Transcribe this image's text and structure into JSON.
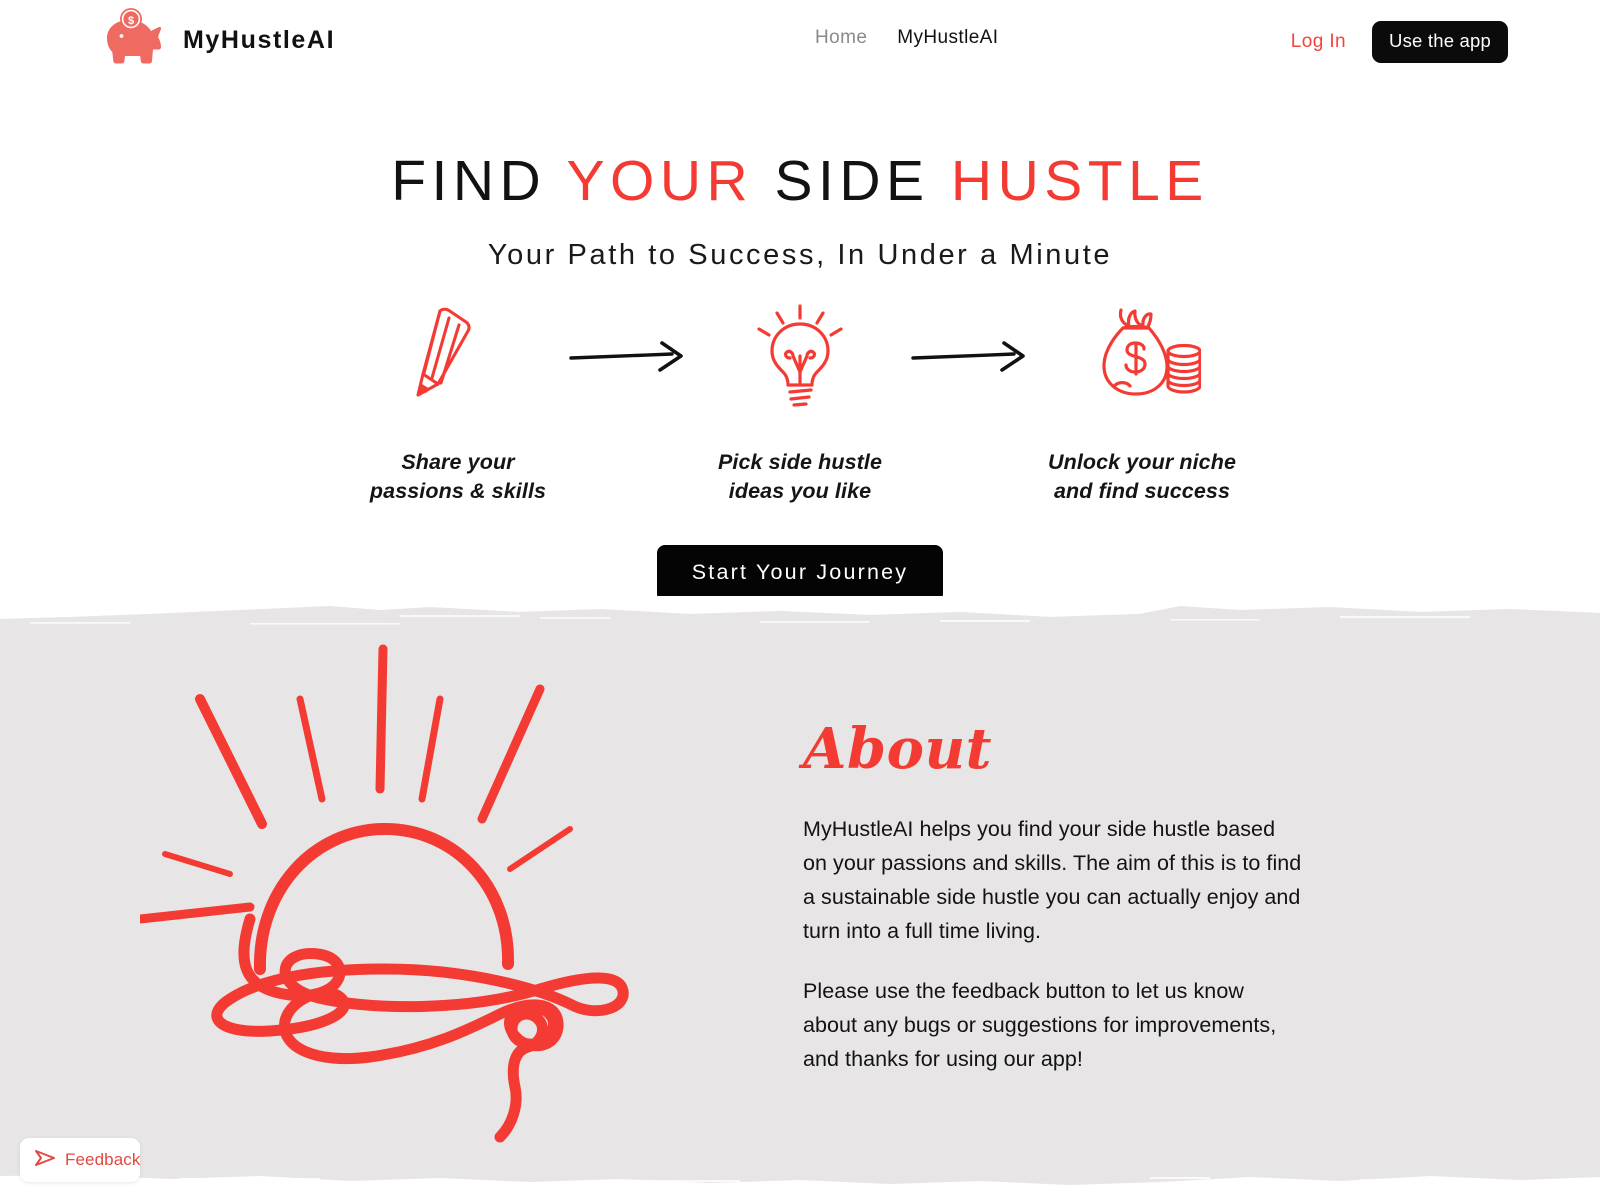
{
  "colors": {
    "brand_red": "#f43b33",
    "logo_pink": "#ef6a61",
    "ink_black": "#121212",
    "section_gray": "#e7e5e5",
    "muted_gray": "#8a8a8a"
  },
  "header": {
    "brand_name": "MyHustleAI",
    "logo_icon": "piggy-bank-icon",
    "nav": [
      {
        "label": "Home",
        "active": false
      },
      {
        "label": "MyHustleAI",
        "active": true
      }
    ],
    "login_label": "Log In",
    "cta_label": "Use the app"
  },
  "hero": {
    "headline_parts": [
      {
        "text": "FIND",
        "color": "dark"
      },
      {
        "text": "YOUR",
        "color": "red"
      },
      {
        "text": "SIDE",
        "color": "dark"
      },
      {
        "text": "HUSTLE",
        "color": "red"
      }
    ],
    "headline_plain": "FIND YOUR SIDE HUSTLE",
    "subheadline": "Your Path to Success, In Under a Minute",
    "steps": [
      {
        "icon": "pencil-icon",
        "label": "Share your\npassions & skills"
      },
      {
        "icon": "lightbulb-icon",
        "label": "Pick side hustle\nideas you like"
      },
      {
        "icon": "money-bag-icon",
        "label": "Unlock your niche\nand find success"
      }
    ],
    "arrow_icon": "arrow-right-icon",
    "cta_label": "Start Your Journey"
  },
  "about": {
    "illustration_icon": "sunrise-over-waves-icon",
    "title": "About",
    "paragraphs": [
      "MyHustleAI helps you find your side hustle based on your passions and skills. The aim of this is to find a sustainable side hustle you can actually enjoy and turn into a full time living.",
      "Please use the feedback button to let us know about any bugs or suggestions for improvements, and thanks for using our app!"
    ]
  },
  "feedback": {
    "icon": "paper-plane-icon",
    "label": "Feedback"
  }
}
